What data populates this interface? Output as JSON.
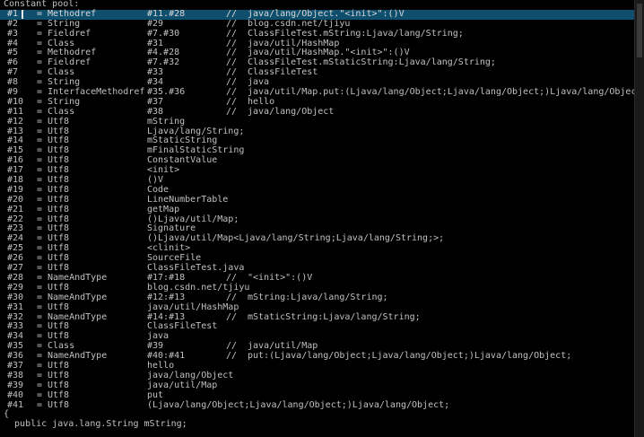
{
  "header": "Constant pool:",
  "rows": [
    {
      "idx": "#1",
      "type": "Methodref",
      "ref": "#11.#28",
      "comment": "java/lang/Object.\"<init>\":()V"
    },
    {
      "idx": "#2",
      "type": "String",
      "ref": "#29",
      "comment": "blog.csdn.net/tjiyu"
    },
    {
      "idx": "#3",
      "type": "Fieldref",
      "ref": "#7.#30",
      "comment": "ClassFileTest.mString:Ljava/lang/String;"
    },
    {
      "idx": "#4",
      "type": "Class",
      "ref": "#31",
      "comment": "java/util/HashMap"
    },
    {
      "idx": "#5",
      "type": "Methodref",
      "ref": "#4.#28",
      "comment": "java/util/HashMap.\"<init>\":()V"
    },
    {
      "idx": "#6",
      "type": "Fieldref",
      "ref": "#7.#32",
      "comment": "ClassFileTest.mStaticString:Ljava/lang/String;"
    },
    {
      "idx": "#7",
      "type": "Class",
      "ref": "#33",
      "comment": "ClassFileTest"
    },
    {
      "idx": "#8",
      "type": "String",
      "ref": "#34",
      "comment": "java"
    },
    {
      "idx": "#9",
      "type": "InterfaceMethodref",
      "ref": "#35.#36",
      "comment": "java/util/Map.put:(Ljava/lang/Object;Ljava/lang/Object;)Ljava/lang/Object;"
    },
    {
      "idx": "#10",
      "type": "String",
      "ref": "#37",
      "comment": "hello"
    },
    {
      "idx": "#11",
      "type": "Class",
      "ref": "#38",
      "comment": "java/lang/Object"
    },
    {
      "idx": "#12",
      "type": "Utf8",
      "ref": "mString",
      "comment": ""
    },
    {
      "idx": "#13",
      "type": "Utf8",
      "ref": "Ljava/lang/String;",
      "comment": ""
    },
    {
      "idx": "#14",
      "type": "Utf8",
      "ref": "mStaticString",
      "comment": ""
    },
    {
      "idx": "#15",
      "type": "Utf8",
      "ref": "mFinalStaticString",
      "comment": ""
    },
    {
      "idx": "#16",
      "type": "Utf8",
      "ref": "ConstantValue",
      "comment": ""
    },
    {
      "idx": "#17",
      "type": "Utf8",
      "ref": "<init>",
      "comment": ""
    },
    {
      "idx": "#18",
      "type": "Utf8",
      "ref": "()V",
      "comment": ""
    },
    {
      "idx": "#19",
      "type": "Utf8",
      "ref": "Code",
      "comment": ""
    },
    {
      "idx": "#20",
      "type": "Utf8",
      "ref": "LineNumberTable",
      "comment": ""
    },
    {
      "idx": "#21",
      "type": "Utf8",
      "ref": "getMap",
      "comment": ""
    },
    {
      "idx": "#22",
      "type": "Utf8",
      "ref": "()Ljava/util/Map;",
      "comment": ""
    },
    {
      "idx": "#23",
      "type": "Utf8",
      "ref": "Signature",
      "comment": ""
    },
    {
      "idx": "#24",
      "type": "Utf8",
      "ref": "()Ljava/util/Map<Ljava/lang/String;Ljava/lang/String;>;",
      "comment": ""
    },
    {
      "idx": "#25",
      "type": "Utf8",
      "ref": "<clinit>",
      "comment": ""
    },
    {
      "idx": "#26",
      "type": "Utf8",
      "ref": "SourceFile",
      "comment": ""
    },
    {
      "idx": "#27",
      "type": "Utf8",
      "ref": "ClassFileTest.java",
      "comment": ""
    },
    {
      "idx": "#28",
      "type": "NameAndType",
      "ref": "#17:#18",
      "comment": "\"<init>\":()V"
    },
    {
      "idx": "#29",
      "type": "Utf8",
      "ref": "blog.csdn.net/tjiyu",
      "comment": ""
    },
    {
      "idx": "#30",
      "type": "NameAndType",
      "ref": "#12:#13",
      "comment": "mString:Ljava/lang/String;"
    },
    {
      "idx": "#31",
      "type": "Utf8",
      "ref": "java/util/HashMap",
      "comment": ""
    },
    {
      "idx": "#32",
      "type": "NameAndType",
      "ref": "#14:#13",
      "comment": "mStaticString:Ljava/lang/String;"
    },
    {
      "idx": "#33",
      "type": "Utf8",
      "ref": "ClassFileTest",
      "comment": ""
    },
    {
      "idx": "#34",
      "type": "Utf8",
      "ref": "java",
      "comment": ""
    },
    {
      "idx": "#35",
      "type": "Class",
      "ref": "#39",
      "comment": "java/util/Map"
    },
    {
      "idx": "#36",
      "type": "NameAndType",
      "ref": "#40:#41",
      "comment": "put:(Ljava/lang/Object;Ljava/lang/Object;)Ljava/lang/Object;"
    },
    {
      "idx": "#37",
      "type": "Utf8",
      "ref": "hello",
      "comment": ""
    },
    {
      "idx": "#38",
      "type": "Utf8",
      "ref": "java/lang/Object",
      "comment": ""
    },
    {
      "idx": "#39",
      "type": "Utf8",
      "ref": "java/util/Map",
      "comment": ""
    },
    {
      "idx": "#40",
      "type": "Utf8",
      "ref": "put",
      "comment": ""
    },
    {
      "idx": "#41",
      "type": "Utf8",
      "ref": "(Ljava/lang/Object;Ljava/lang/Object;)Ljava/lang/Object;",
      "comment": ""
    }
  ],
  "eq": "=",
  "comment_marker": "//",
  "open_brace": "{",
  "field_decl": "  public java.lang.String mString;",
  "colors": {
    "background": "#000000",
    "text": "#c0c0c0",
    "selection": "#0f4f6e"
  }
}
